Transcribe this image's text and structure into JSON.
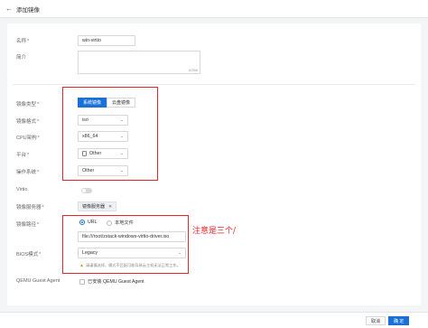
{
  "header": {
    "back_icon": "arrow-left-icon",
    "title": "添加镜像"
  },
  "form": {
    "name": {
      "label": "名称",
      "value": "win-virtio"
    },
    "description": {
      "label": "简介",
      "value": "",
      "counter": "0/256"
    },
    "image_type": {
      "label": "镜像类型",
      "options": [
        "系统镜像",
        "云盘镜像"
      ],
      "selected": "系统镜像"
    },
    "image_format": {
      "label": "镜像格式",
      "value": "iso"
    },
    "cpu_arch": {
      "label": "CPU架构",
      "value": "x86_64"
    },
    "platform": {
      "label": "平台",
      "value": "Other"
    },
    "os": {
      "label": "操作系统",
      "value": "Other"
    },
    "virtio": {
      "label": "Virtio",
      "enabled": false
    },
    "image_server": {
      "label": "镜像服务器",
      "tag": "镜像服务器"
    },
    "image_path": {
      "label": "镜像路径",
      "options": [
        "URL",
        "本地文件"
      ],
      "selected": "URL",
      "value": "file:///root/zstack-windows-virtio-driver.iso"
    },
    "bios_mode": {
      "label": "BIOS模式",
      "value": "Legacy",
      "warning": "请谨慎选择，模式不匹配可能导致云主机无法正常工作。"
    },
    "qemu_agent": {
      "label": "QEMU Guest Agent",
      "checkbox_label": "已安装 QEMU Guest Agent",
      "checked": false
    }
  },
  "annotation": {
    "text": "注意是三个/",
    "color": "#e8232b"
  },
  "footer": {
    "cancel_label": "取消",
    "confirm_label": "确 定"
  },
  "colors": {
    "primary": "#1b70d8",
    "required": "#e54545",
    "warning": "#e69a1e"
  }
}
